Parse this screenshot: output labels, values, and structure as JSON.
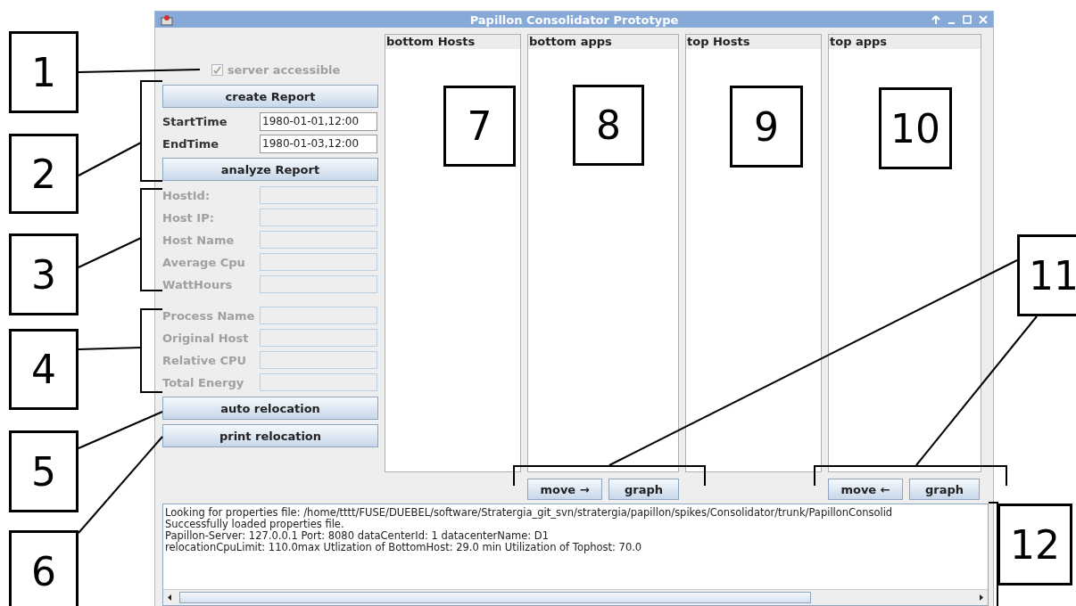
{
  "window": {
    "title": "Papillon Consolidator Prototype"
  },
  "server_checkbox": {
    "label": "server accessible",
    "checked": true,
    "disabled": true
  },
  "report": {
    "create_button": "create Report",
    "fields": [
      {
        "label": "StartTime",
        "value": "1980-01-01,12:00",
        "disabled": false
      },
      {
        "label": "EndTime",
        "value": "1980-01-03,12:00",
        "disabled": false
      }
    ],
    "analyze_button": "analyze Report"
  },
  "host_fields": [
    {
      "label": "HostId:",
      "disabled": true
    },
    {
      "label": "Host IP:",
      "disabled": true
    },
    {
      "label": "Host Name",
      "disabled": true
    },
    {
      "label": "Average Cpu",
      "disabled": true
    },
    {
      "label": "WattHours",
      "disabled": true
    }
  ],
  "process_fields": [
    {
      "label": "Process Name",
      "disabled": true
    },
    {
      "label": "Original Host",
      "disabled": true
    },
    {
      "label": "Relative CPU",
      "disabled": true
    },
    {
      "label": "Total Energy",
      "disabled": true
    }
  ],
  "relocation_buttons": [
    "auto relocation",
    "print relocation"
  ],
  "lists": [
    {
      "title": "bottom Hosts"
    },
    {
      "title": "bottom apps",
      "buttons": [
        "move →",
        "graph"
      ]
    },
    {
      "title": "top Hosts"
    },
    {
      "title": "top apps",
      "buttons": [
        "move ←",
        "graph"
      ]
    }
  ],
  "log": {
    "lines": [
      "Looking for properties file: /home/tttt/FUSE/DUEBEL/software/Stratergia_git_svn/stratergia/papillon/spikes/Consolidator/trunk/PapillonConsolid",
      "Successfully loaded properties file.",
      "Papillon-Server: 127.0.0.1 Port: 8080 dataCenterId: 1 datacenterName: D1",
      "relocationCpuLimit: 110.0max Utlization of BottomHost: 29.0 min Utilization of Tophost: 70.0"
    ]
  },
  "callouts": [
    "1",
    "2",
    "3",
    "4",
    "5",
    "6",
    "7",
    "8",
    "9",
    "10",
    "11",
    "12"
  ]
}
